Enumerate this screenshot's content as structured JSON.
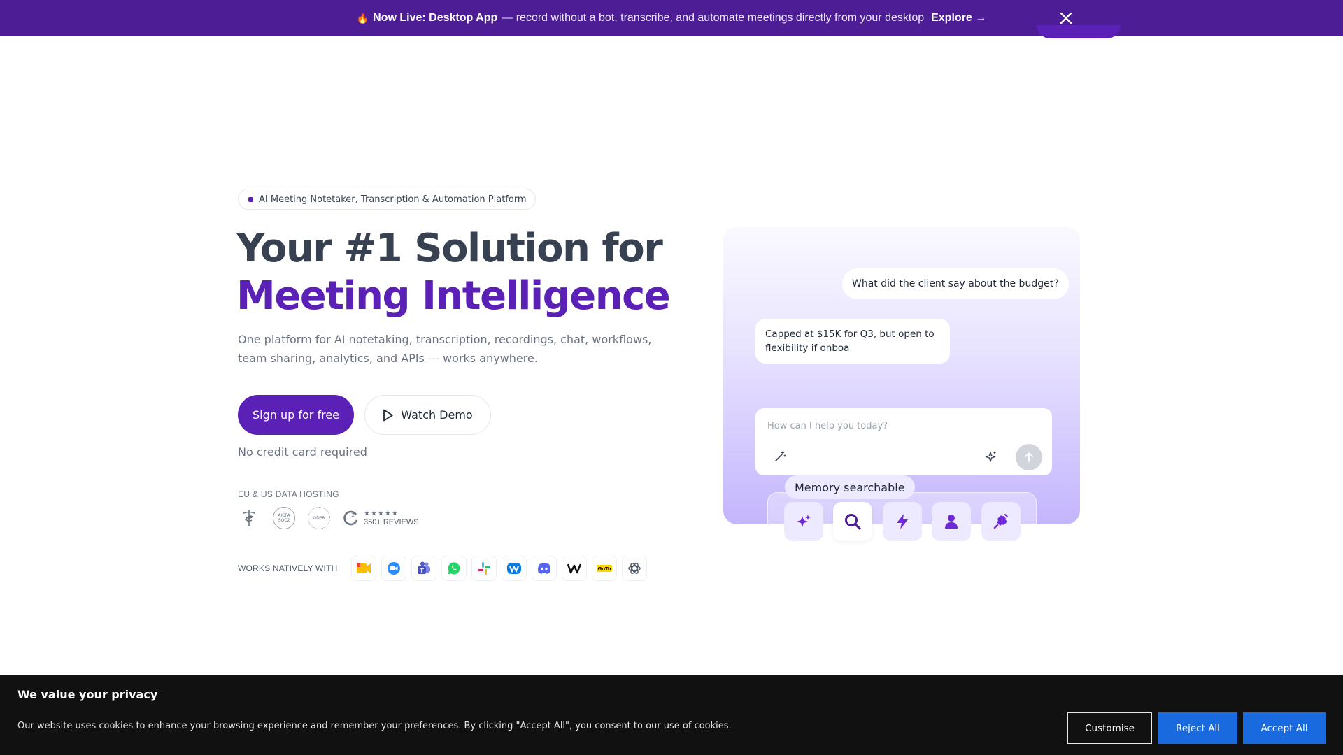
{
  "banner": {
    "icon": "fire-icon",
    "title": "Now Live: Desktop App",
    "message": "— record without a bot, transcribe, and automate meetings directly from your desktop",
    "link": "Explore →"
  },
  "hero": {
    "badge": "AI Meeting Notetaker, Transcription & Automation Platform",
    "headline_line1": "Your #1 Solution for",
    "headline_line2": "Meeting Intelligence",
    "subtext": "One platform for AI notetaking, transcription, recordings, chat, workflows, team sharing, analytics, and APIs — works anywhere.",
    "primary_cta": "Sign up for free",
    "secondary_cta": "Watch Demo",
    "note": "No credit card required",
    "hosting_label": "EU & US DATA HOSTING",
    "certs": {
      "soc2_top": "AICPA",
      "soc2_bottom": "SOC2",
      "gdpr": "GDPR",
      "g2_stars": "★★★★★",
      "g2_reviews": "350+ REVIEWS"
    },
    "works_label": "WORKS NATIVELY WITH",
    "integrations": [
      "google-meet-icon",
      "zoom-icon",
      "teams-icon",
      "whatsapp-icon",
      "slack-icon",
      "webex-icon",
      "discord-icon",
      "webflow-icon",
      "gotomeeting-icon",
      "openai-icon"
    ]
  },
  "chat": {
    "user_message": "What did the client say about the budget?",
    "bot_message": "Capped at $15K for Q3, but open to flexibility if onboa",
    "input_placeholder": "How can I help you today?",
    "tooltip": "Memory searchable"
  },
  "cookie": {
    "title": "We value your privacy",
    "text": "Our website uses cookies to enhance your browsing experience and remember your preferences. By clicking \"Accept All\", you consent to our use of cookies.",
    "customise": "Customise",
    "reject": "Reject All",
    "accept": "Accept All"
  },
  "colors": {
    "brand": "#5b21b6",
    "banner": "#4c1d95",
    "cookie_bg": "#111111",
    "cookie_button": "#1a6adf"
  }
}
